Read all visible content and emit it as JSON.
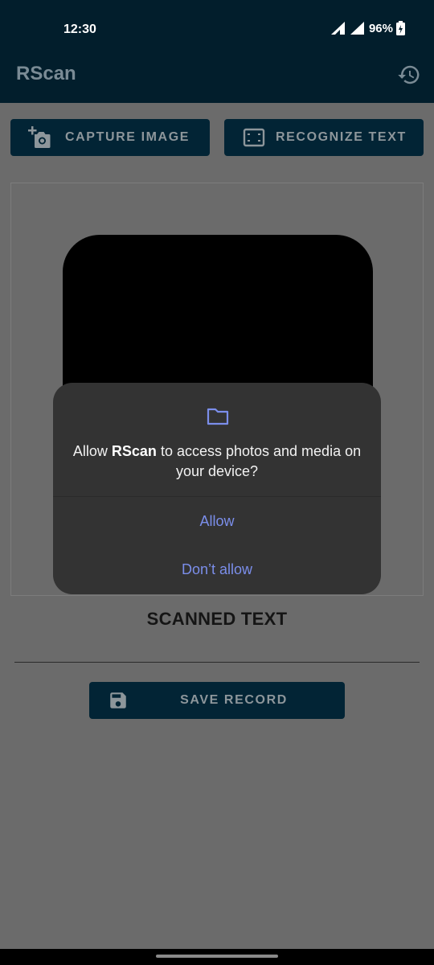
{
  "status_bar": {
    "time": "12:30",
    "battery": "96%"
  },
  "app_bar": {
    "title": "RScan",
    "history_icon": "history-icon"
  },
  "actions": {
    "capture_label": "CAPTURE IMAGE",
    "capture_icon": "add-photo-icon",
    "recognize_label": "RECOGNIZE TEXT",
    "recognize_icon": "crop-free-icon"
  },
  "content": {
    "scanned_title": "SCANNED TEXT",
    "save_label": "SAVE RECORD",
    "save_icon": "floppy-disk-icon"
  },
  "permission_dialog": {
    "icon": "folder-icon",
    "message_prefix": "Allow ",
    "app_name": "RScan",
    "message_suffix": " to access photos and media on your device?",
    "allow_label": "Allow",
    "deny_label": "Don’t allow"
  },
  "colors": {
    "app_bar": "#021e2c",
    "button": "#022435",
    "scrim": "#6b6b6b",
    "dialog": "#333333",
    "dialog_action": "#7b8eea"
  }
}
